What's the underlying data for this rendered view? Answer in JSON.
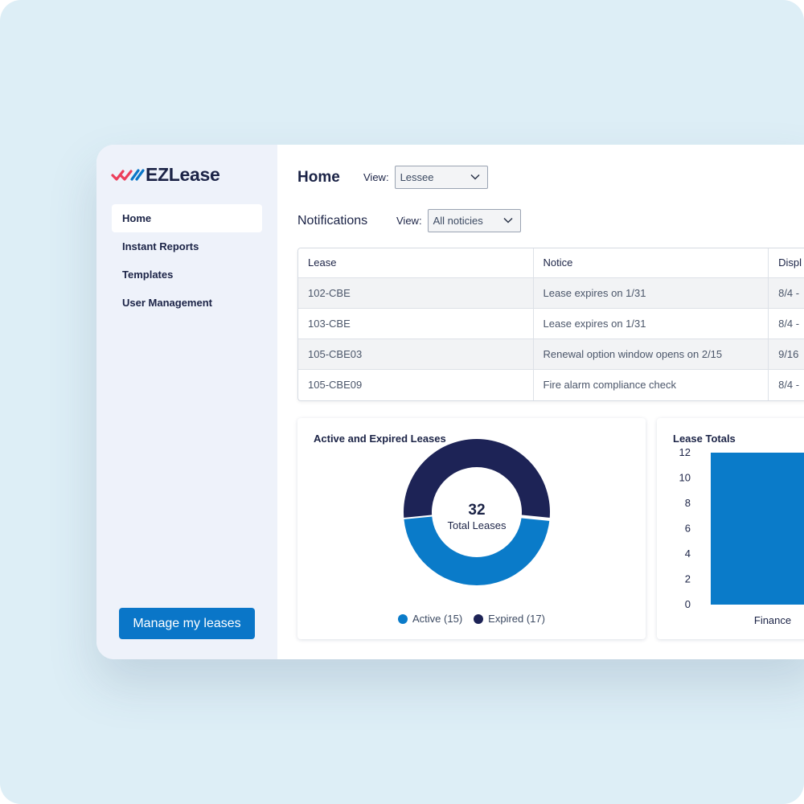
{
  "app": {
    "name": "EZLease"
  },
  "sidebar": {
    "items": [
      {
        "label": "Home",
        "active": true
      },
      {
        "label": "Instant Reports",
        "active": false
      },
      {
        "label": "Templates",
        "active": false
      },
      {
        "label": "User Management",
        "active": false
      }
    ],
    "cta_label": "Manage my leases"
  },
  "header": {
    "title": "Home",
    "view_label": "View:",
    "view_value": "Lessee"
  },
  "notifications": {
    "title": "Notifications",
    "view_label": "View:",
    "view_value": "All noticies",
    "columns": [
      "Lease",
      "Notice",
      "Displ"
    ],
    "rows": [
      {
        "lease": "102-CBE",
        "notice": "Lease expires on 1/31",
        "display": "8/4 -"
      },
      {
        "lease": "103-CBE",
        "notice": "Lease expires on 1/31",
        "display": "8/4 -"
      },
      {
        "lease": "105-CBE03",
        "notice": "Renewal option window opens on 2/15",
        "display": "9/16"
      },
      {
        "lease": "105-CBE09",
        "notice": "Fire alarm compliance check",
        "display": "8/4 -"
      }
    ]
  },
  "colors": {
    "primary": "#0a76c8",
    "navy": "#1b2346",
    "active_series": "#0a7bc9",
    "expired_series": "#1d2356",
    "logo_red": "#ec3f5b",
    "logo_blue": "#0a76c8"
  },
  "chart_data": [
    {
      "type": "pie",
      "title": "Active and Expired Leases",
      "center_value": "32",
      "center_label": "Total Leases",
      "series": [
        {
          "name": "Active",
          "value": 15,
          "legend": "Active (15)",
          "color": "#0a7bc9"
        },
        {
          "name": "Expired",
          "value": 17,
          "legend": "Expired (17)",
          "color": "#1d2356"
        }
      ]
    },
    {
      "type": "bar",
      "title": "Lease Totals",
      "categories": [
        "Finance"
      ],
      "values": [
        12
      ],
      "ylim": [
        0,
        12
      ],
      "yticks": [
        0,
        2,
        4,
        6,
        8,
        10,
        12
      ],
      "color": "#0a7bc9"
    }
  ]
}
